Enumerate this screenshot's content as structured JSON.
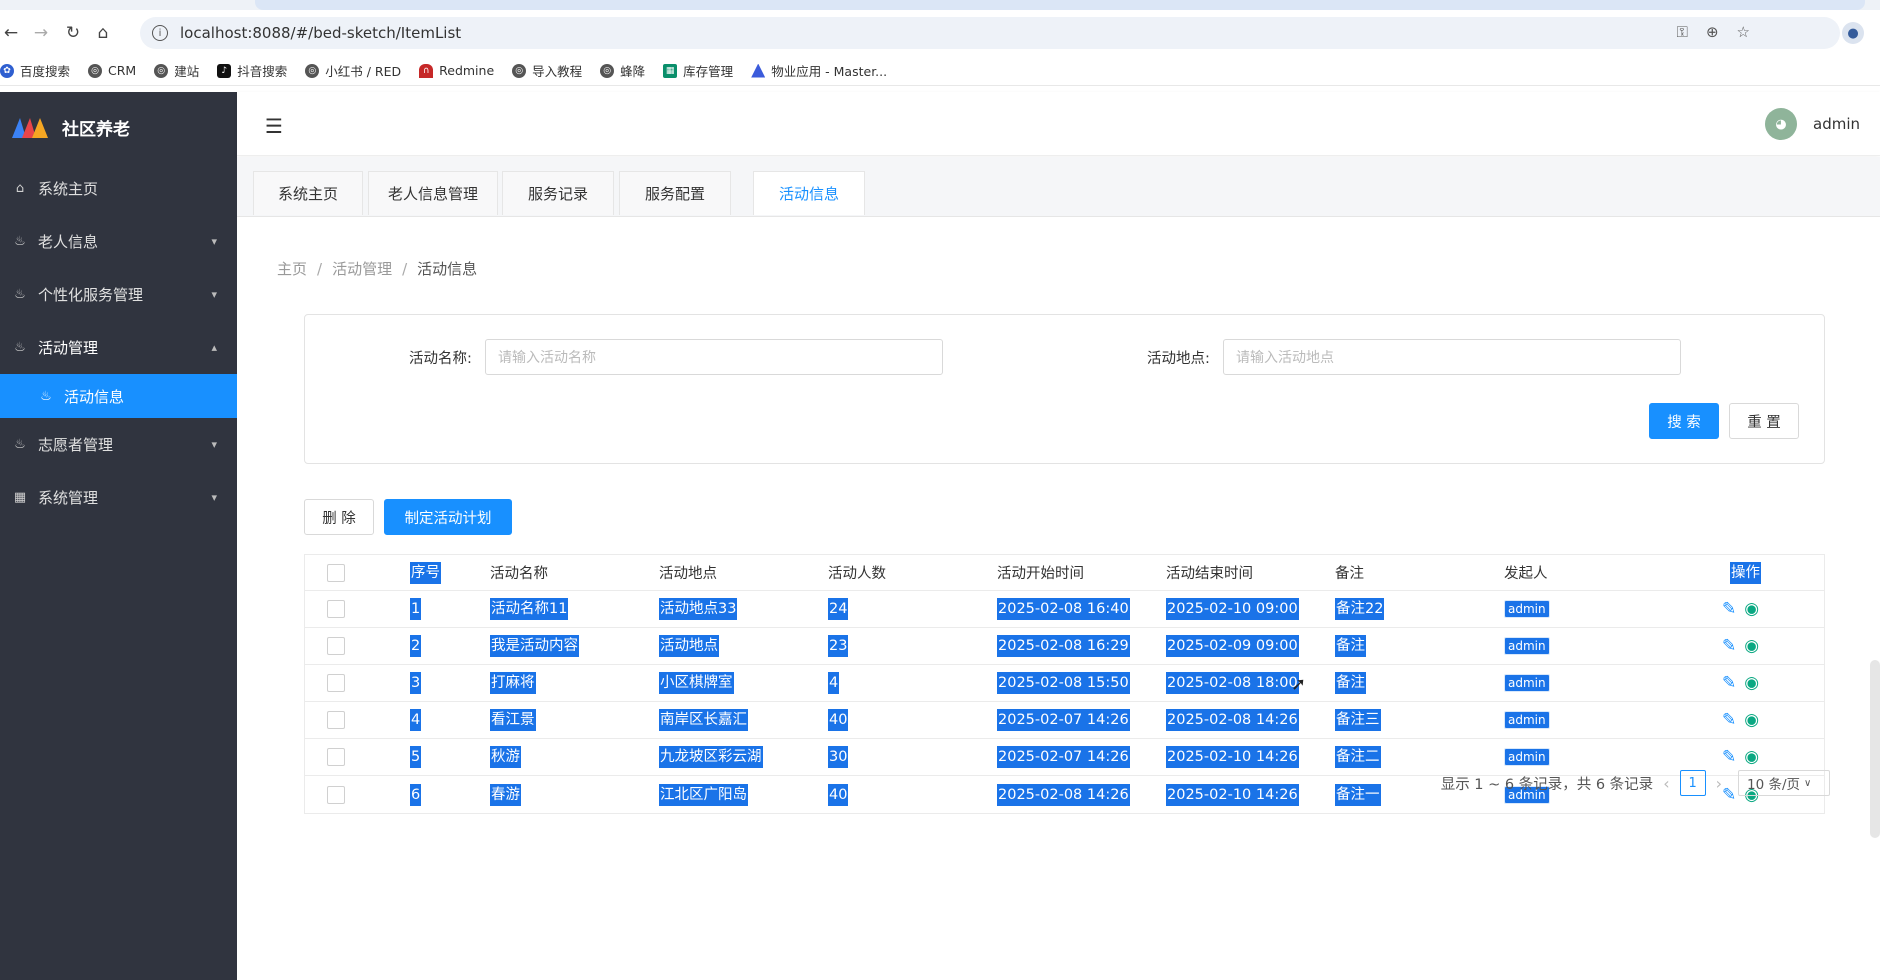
{
  "browser": {
    "url": "localhost:8088/#/bed-sketch/ItemList",
    "bookmarks": [
      "百度搜索",
      "CRM",
      "建站",
      "抖音搜索",
      "小红书 / RED",
      "Redmine",
      "导入教程",
      "蜂降",
      "库存管理",
      "物业应用 - Master..."
    ]
  },
  "sidebar": {
    "app_title": "社区养老",
    "items": [
      {
        "label": "系统主页",
        "icon": "home-icon"
      },
      {
        "label": "老人信息",
        "icon": "fire-icon"
      },
      {
        "label": "个性化服务管理",
        "icon": "fire-icon"
      },
      {
        "label": "活动管理",
        "icon": "fire-icon"
      },
      {
        "label": "活动信息",
        "icon": "fire-icon"
      },
      {
        "label": "志愿者管理",
        "icon": "fire-icon"
      },
      {
        "label": "系统管理",
        "icon": "grid-icon"
      }
    ]
  },
  "header": {
    "username": "admin"
  },
  "tabs": [
    "系统主页",
    "老人信息管理",
    "服务记录",
    "服务配置",
    "活动信息"
  ],
  "breadcrumb": {
    "home": "主页",
    "parent": "活动管理",
    "current": "活动信息",
    "sep": "/"
  },
  "search": {
    "name_label": "活动名称:",
    "name_placeholder": "请输入活动名称",
    "place_label": "活动地点:",
    "place_placeholder": "请输入活动地点",
    "search_button": "搜 索",
    "reset_button": "重 置"
  },
  "toolbar": {
    "delete_button": "删 除",
    "create_button": "制定活动计划"
  },
  "table": {
    "headers": [
      "序号",
      "活动名称",
      "活动地点",
      "活动人数",
      "活动开始时间",
      "活动结束时间",
      "备注",
      "发起人",
      "操作"
    ],
    "rows": [
      [
        "1",
        "活动名称11",
        "活动地点33",
        "24",
        "2025-02-08 16:40",
        "2025-02-10 09:00",
        "备注22",
        "admin"
      ],
      [
        "2",
        "我是活动内容",
        "活动地点",
        "23",
        "2025-02-08 16:29",
        "2025-02-09 09:00",
        "备注",
        "admin"
      ],
      [
        "3",
        "打麻将",
        "小区棋牌室",
        "4",
        "2025-02-08 15:50",
        "2025-02-08 18:00",
        "备注",
        "admin"
      ],
      [
        "4",
        "看江景",
        "南岸区长嘉汇",
        "40",
        "2025-02-07 14:26",
        "2025-02-08 14:26",
        "备注三",
        "admin"
      ],
      [
        "5",
        "秋游",
        "九龙坡区彩云湖",
        "30",
        "2025-02-07 14:26",
        "2025-02-10 14:26",
        "备注二",
        "admin"
      ],
      [
        "6",
        "春游",
        "江北区广阳岛",
        "40",
        "2025-02-08 14:26",
        "2025-02-10 14:26",
        "备注一",
        "admin"
      ]
    ]
  },
  "pagination": {
    "summary": "显示 1 ~ 6 条记录，共 6 条记录",
    "current_page": "1",
    "page_size": "10 条/页"
  },
  "colors": {
    "primary": "#1890ff",
    "sidebar_bg": "#30343f",
    "selection": "#1a73e8"
  }
}
